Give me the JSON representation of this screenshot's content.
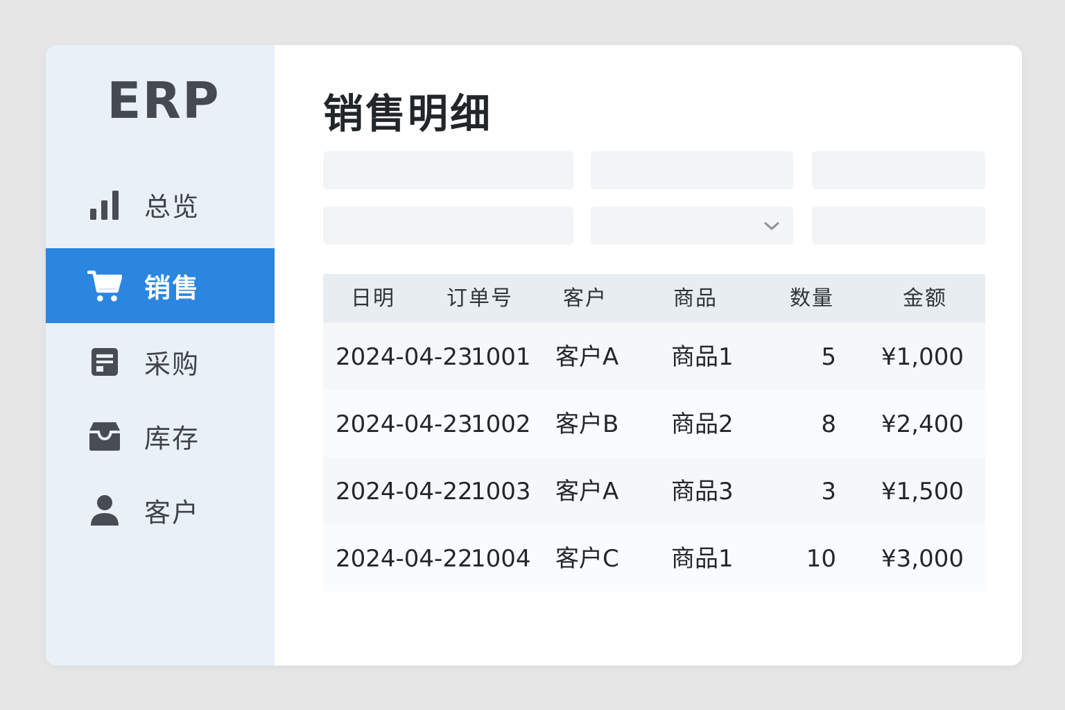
{
  "app": {
    "logo": "ERP"
  },
  "sidebar": {
    "items": [
      {
        "label": "总览",
        "icon": "bar-chart-icon",
        "active": false
      },
      {
        "label": "销售",
        "icon": "shopping-cart-icon",
        "active": true
      },
      {
        "label": "采购",
        "icon": "document-icon",
        "active": false
      },
      {
        "label": "库存",
        "icon": "inbox-box-icon",
        "active": false
      },
      {
        "label": "客户",
        "icon": "user-icon",
        "active": false
      }
    ]
  },
  "main": {
    "title": "销售明细",
    "filters": [
      {
        "value": "",
        "placeholder": ""
      },
      {
        "value": "",
        "placeholder": ""
      },
      {
        "value": "",
        "placeholder": ""
      },
      {
        "value": "",
        "placeholder": ""
      },
      {
        "value": "",
        "placeholder": "",
        "icon": "chevron-down-icon"
      },
      {
        "value": "",
        "placeholder": ""
      }
    ],
    "table": {
      "columns": [
        "日明",
        "订单号",
        "客户",
        "商品",
        "数量",
        "金额"
      ],
      "rows": [
        [
          "2024-04-23",
          "1001",
          "客户A",
          "商品1",
          "5",
          "¥1,000"
        ],
        [
          "2024-04-23",
          "1002",
          "客户B",
          "商品2",
          "8",
          "¥2,400"
        ],
        [
          "2024-04-22",
          "1003",
          "客户A",
          "商品3",
          "3",
          "¥1,500"
        ],
        [
          "2024-04-22",
          "1004",
          "客户C",
          "商品1",
          "10",
          "¥3,000"
        ]
      ]
    }
  },
  "colors": {
    "accent": "#2b86df",
    "sidebar_bg": "#eaf0f8",
    "page_bg": "#e6e6e6",
    "text": "#23272b"
  }
}
